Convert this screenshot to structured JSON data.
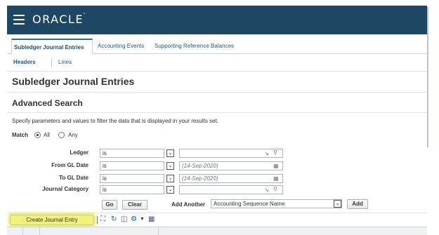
{
  "header": {
    "app_logo": "ORACLE",
    "icons": [
      "hamburger-menu-icon"
    ]
  },
  "tabs": [
    {
      "label": "Subledger Journal Entries",
      "active": true
    },
    {
      "label": "Accounting Events",
      "active": false
    },
    {
      "label": "Supporting Reference Balances",
      "active": false
    }
  ],
  "subtabs": [
    {
      "label": "Headers",
      "active": true
    },
    {
      "label": "Lines",
      "active": false
    }
  ],
  "page_title": "Subledger Journal Entries",
  "search": {
    "section_title": "Advanced Search",
    "instructions": "Specify parameters and values to filter the data that is displayed in your results set.",
    "match_label": "Match",
    "match_options": [
      {
        "label": "All",
        "selected": true
      },
      {
        "label": "Any",
        "selected": false
      }
    ],
    "fields": [
      {
        "label": "Ledger",
        "operator": "is",
        "value": "",
        "icons": [
          "list-of-values-icon",
          "search-icon"
        ]
      },
      {
        "label": "From GL Date",
        "operator": "is",
        "value": "(14-Sep-2020)",
        "icons": [
          "calendar-icon"
        ]
      },
      {
        "label": "To GL Date",
        "operator": "is",
        "value": "(14-Sep-2020)",
        "icons": [
          "calendar-icon"
        ]
      },
      {
        "label": "Journal Category",
        "operator": "is",
        "value": "",
        "icons": [
          "list-of-values-icon",
          "search-icon"
        ]
      }
    ],
    "go_label": "Go",
    "clear_label": "Clear",
    "add_another_label": "Add Another",
    "add_another_value": "Accounting Sequence Name",
    "add_label": "Add"
  },
  "toolbar": {
    "create_label": "Create Journal Entry",
    "icons": [
      "expand-icon",
      "refresh-icon",
      "export-icon",
      "gear-icon",
      "chevron-down-icon",
      "columns-icon"
    ]
  },
  "colors": {
    "header_bg": "#1d4762",
    "link": "#1d5a85",
    "highlight": "#f0f27a"
  }
}
